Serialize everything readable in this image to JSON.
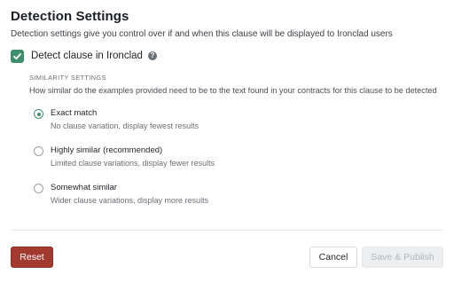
{
  "title": "Detection Settings",
  "subtitle": "Detection settings give you control over if and when this clause will be displayed to Ironclad users",
  "detect": {
    "label": "Detect clause in Ironclad",
    "checked": true,
    "help_icon": "?"
  },
  "similarity": {
    "heading": "SIMILARITY SETTINGS",
    "description": "How similar do the examples provided need to be to the text found in your contracts for this clause to be detected",
    "options": [
      {
        "label": "Exact match",
        "hint": "No clause variation, display fewest results",
        "selected": true
      },
      {
        "label": "Highly similar (recommended)",
        "hint": "Limited clause variations, display fewer results",
        "selected": false
      },
      {
        "label": "Somewhat similar",
        "hint": "Wider clause variations, display more results",
        "selected": false
      }
    ]
  },
  "footer": {
    "reset_label": "Reset",
    "cancel_label": "Cancel",
    "publish_label": "Save & Publish",
    "publish_disabled": true
  },
  "colors": {
    "accent": "#3f8f6e",
    "danger": "#a23a2f"
  }
}
